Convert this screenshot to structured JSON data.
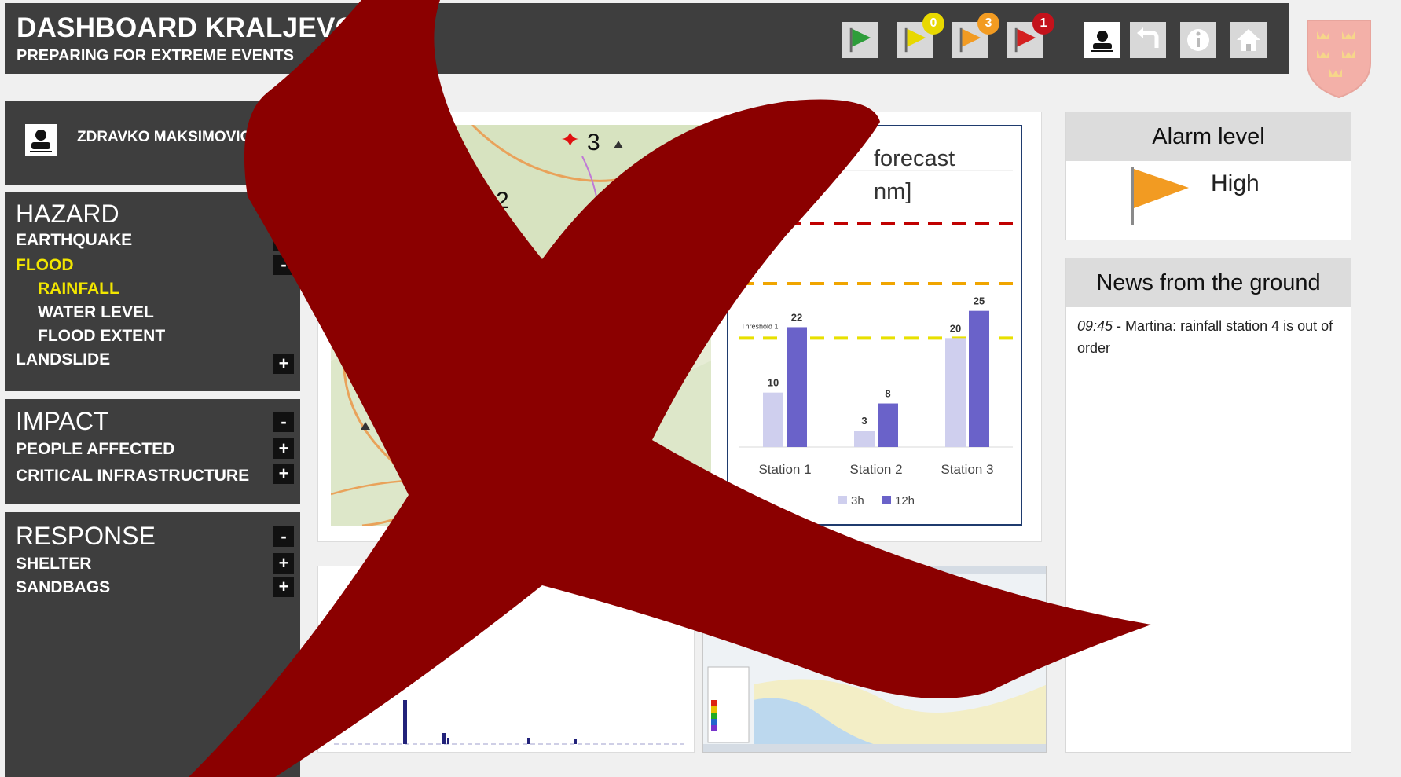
{
  "header": {
    "title": "DASHBOARD KRALJEVO",
    "subtitle": "PREPARING FOR EXTREME EVENTS",
    "flag_buttons": [
      {
        "name": "green",
        "color": "#2e9d3a",
        "badge": ""
      },
      {
        "name": "yellow",
        "color": "#e8d800",
        "badge": "0",
        "badge_color": "#e8d800"
      },
      {
        "name": "orange",
        "color": "#f29b22",
        "badge": "3",
        "badge_color": "#f29b22"
      },
      {
        "name": "red",
        "color": "#d42020",
        "badge": "1",
        "badge_color": "#c3121b"
      }
    ],
    "system_buttons": [
      "user-icon",
      "refresh-icon",
      "info-icon",
      "home-icon"
    ]
  },
  "user": {
    "name": "ZDRAVKO MAKSIMOVIC"
  },
  "sidebar": {
    "hazard": {
      "title": "HAZARD",
      "items": [
        {
          "label": "EARTHQUAKE",
          "toggle": "+"
        },
        {
          "label": "FLOOD",
          "toggle": "-"
        },
        {
          "label": "RAINFALL"
        },
        {
          "label": "WATER  LEVEL"
        },
        {
          "label": "FLOOD  EXTENT"
        },
        {
          "label": "LANDSLIDE",
          "toggle": "+"
        }
      ]
    },
    "impact": {
      "title": "IMPACT",
      "toggle": "-",
      "items": [
        {
          "label": "PEOPLE AFFECTED",
          "toggle": "+"
        },
        {
          "label": "CRITICAL  INFRASTRUCTURE",
          "toggle": "+"
        }
      ]
    },
    "response": {
      "title": "RESPONSE",
      "toggle": "-",
      "items": [
        {
          "label": "SHELTER",
          "toggle": "+"
        },
        {
          "label": "SANDBAGS",
          "toggle": "+"
        }
      ]
    }
  },
  "map": {
    "markers": [
      {
        "label": "3"
      },
      {
        "label": "2"
      }
    ]
  },
  "chart": {
    "title_lines": [
      "forecast",
      "nm]"
    ],
    "threshold_label": "Threshold 1"
  },
  "chart_data": {
    "type": "bar",
    "categories": [
      "Station 1",
      "Station 2",
      "Station 3"
    ],
    "series": [
      {
        "name": "3h",
        "values": [
          10,
          3,
          20
        ],
        "color": "#cfcfee"
      },
      {
        "name": "12h",
        "values": [
          22,
          8,
          25
        ],
        "color": "#6a62c9"
      }
    ],
    "thresholds": [
      {
        "value": 20,
        "color": "#e8e000"
      },
      {
        "value": 30,
        "color": "#f0a500"
      },
      {
        "value": 41,
        "color": "#c00000"
      }
    ],
    "ylim": [
      0,
      45
    ],
    "legend": "bottom"
  },
  "alarm": {
    "title": "Alarm level",
    "level": "High",
    "flag_color": "#f29b22"
  },
  "news": {
    "title": "News from the ground",
    "entries": [
      {
        "time": "09:45",
        "text": " - Martina: rainfall station 4 is out of order"
      }
    ]
  },
  "overlay": {
    "color": "#8b0000"
  }
}
